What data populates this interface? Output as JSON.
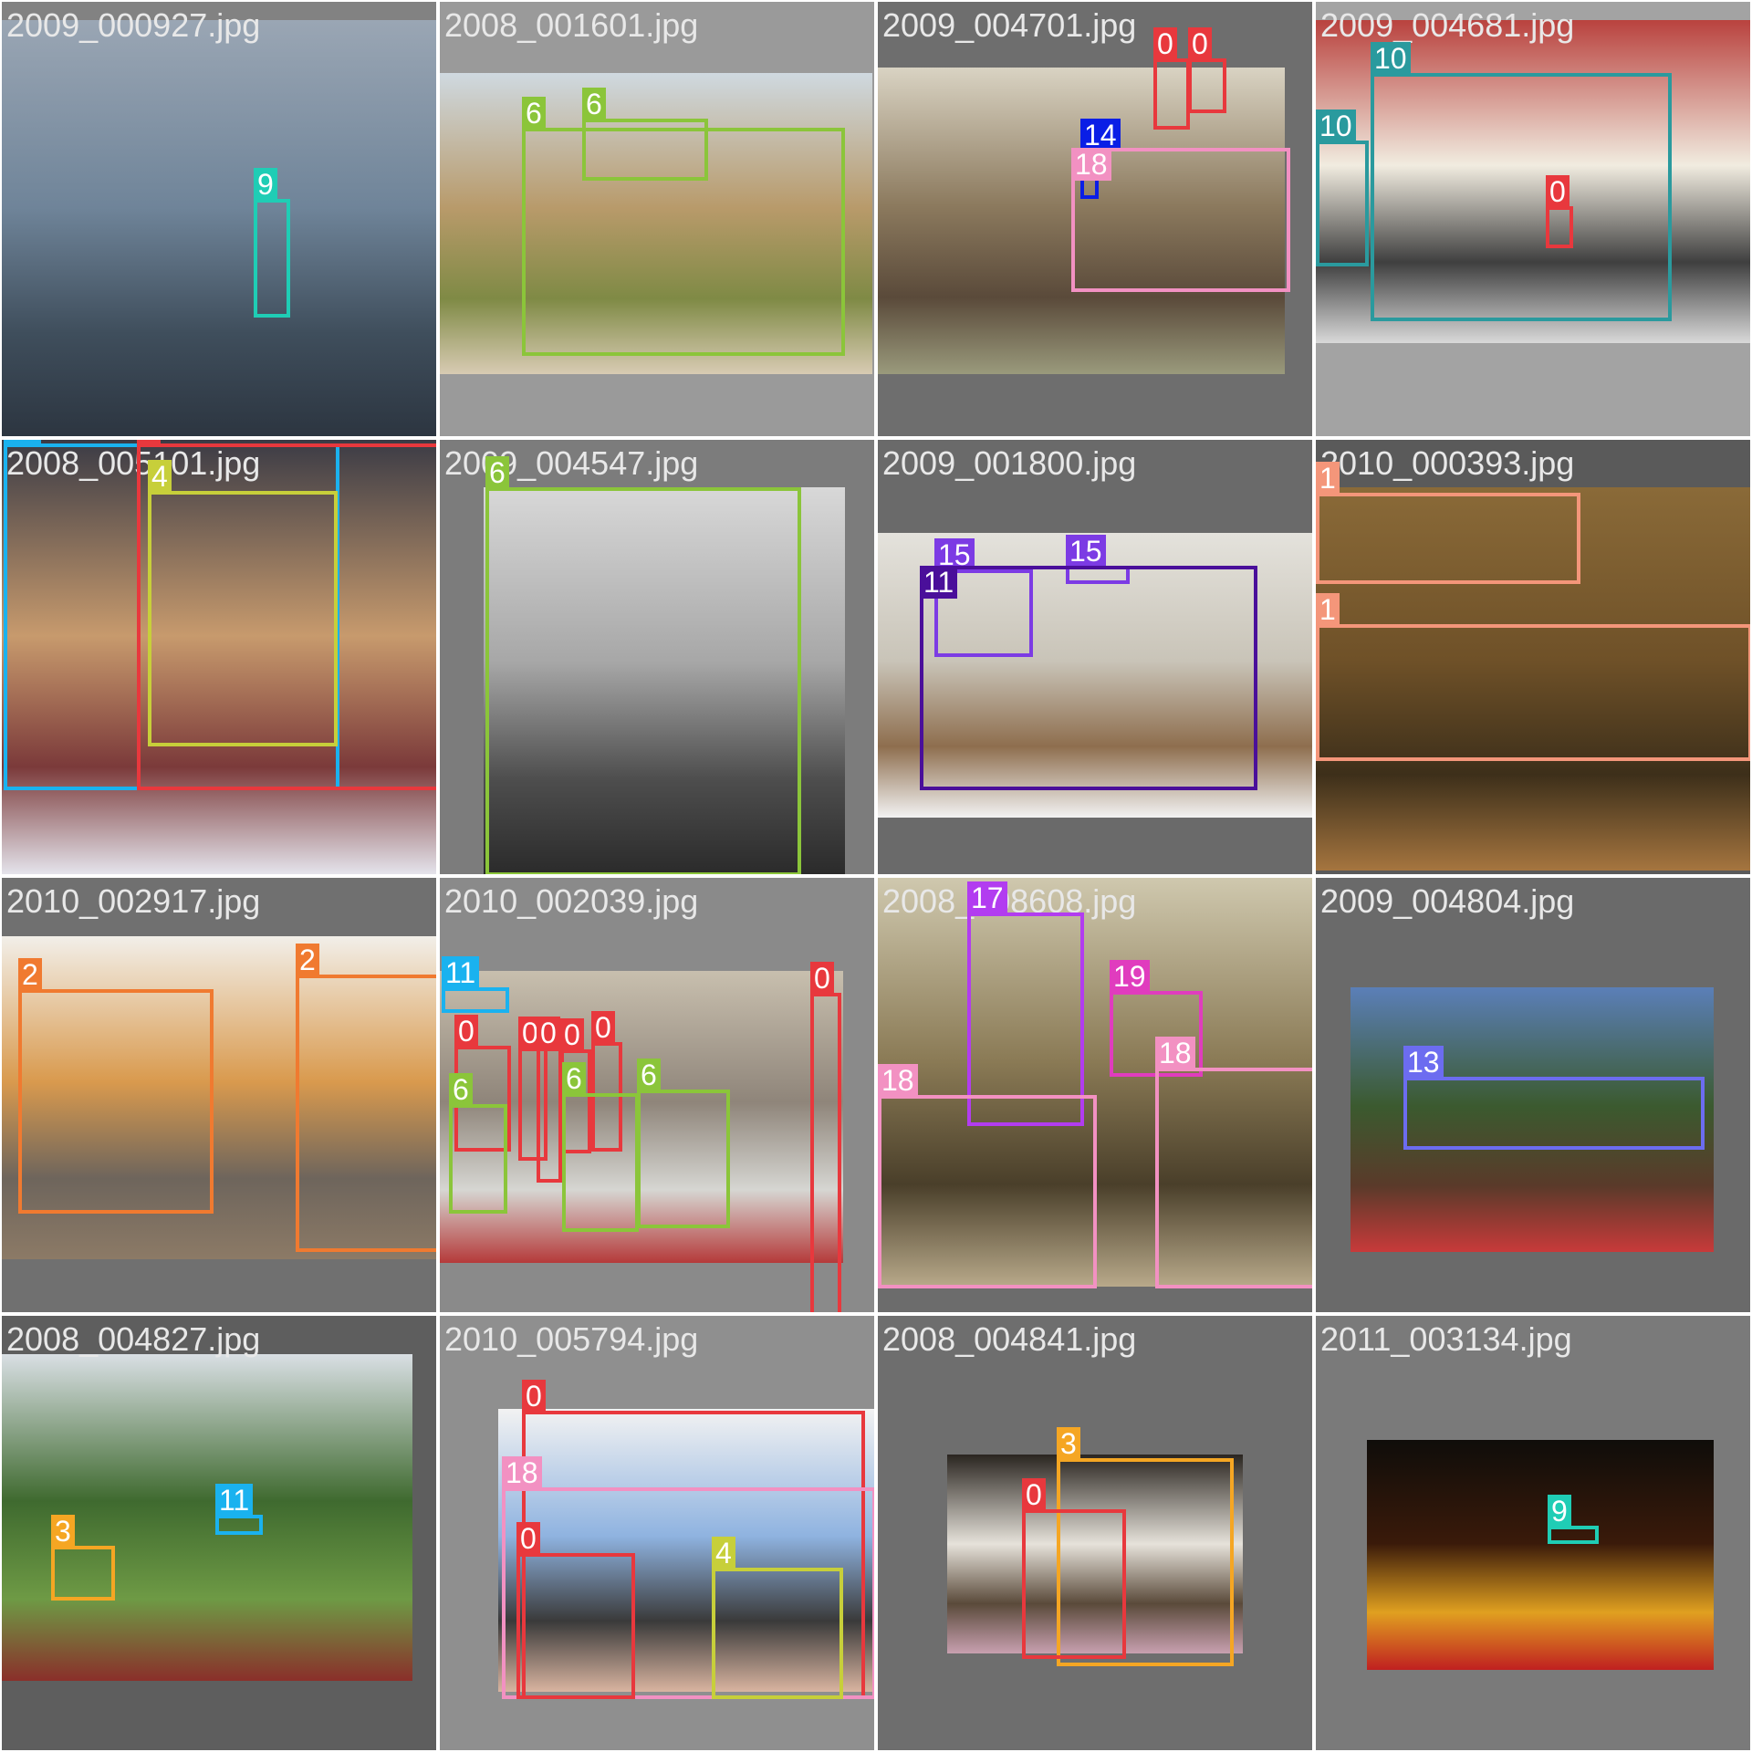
{
  "mosaic": {
    "cells": [
      {
        "filename": "2009_000927.jpg",
        "background": "#828282",
        "image": {
          "scene": "city skyline over water",
          "colors": [
            "#9aa6b4",
            "#6f8499",
            "#3f4e5c",
            "#2c3540"
          ]
        },
        "boxes": [
          {
            "label": "9",
            "color": "#1fcdb5"
          }
        ]
      },
      {
        "filename": "2008_001601.jpg",
        "background": "#9a9a9a",
        "image": {
          "scene": "sheep in grass",
          "colors": [
            "#cfd9e0",
            "#b89a6a",
            "#7f8a45",
            "#d8cbb3"
          ]
        },
        "boxes": [
          {
            "label": "6",
            "color": "#8bc53a"
          },
          {
            "label": "6",
            "color": "#8bc53a"
          }
        ]
      },
      {
        "filename": "2009_004701.jpg",
        "background": "#6e6e6e",
        "image": {
          "scene": "living room with sofa",
          "colors": [
            "#d9d3c3",
            "#8c7a5e",
            "#5a4a3a",
            "#9a9a7c"
          ]
        },
        "boxes": [
          {
            "label": "0",
            "color": "#e8383d"
          },
          {
            "label": "0",
            "color": "#e8383d"
          },
          {
            "label": "14",
            "color": "#0a1ee6"
          },
          {
            "label": "18",
            "color": "#f291c2"
          }
        ]
      },
      {
        "filename": "2009_004681.jpg",
        "background": "#a3a3a3",
        "image": {
          "scene": "double-decker bus",
          "colors": [
            "#b9423e",
            "#f1ece0",
            "#3f3f3f",
            "#d9d9d9"
          ]
        },
        "boxes": [
          {
            "label": "10",
            "color": "#2a9a9e"
          },
          {
            "label": "10",
            "color": "#2a9a9e"
          },
          {
            "label": "0",
            "color": "#e8383d"
          }
        ]
      },
      {
        "filename": "2008_005101.jpg",
        "background": "#555555",
        "image": {
          "scene": "puppy in gloved hands",
          "colors": [
            "#3b3b45",
            "#c79a6d",
            "#7b3a3a",
            "#e6e6ee"
          ]
        },
        "boxes": [
          {
            "label": "11",
            "color": "#1ab2ef"
          },
          {
            "label": "0",
            "color": "#e8383d"
          },
          {
            "label": "4",
            "color": "#c7cf3a"
          }
        ]
      },
      {
        "filename": "2009_004547.jpg",
        "background": "#7c7c7c",
        "image": {
          "scene": "sheep face close-up (grayscale)",
          "colors": [
            "#d8d8d8",
            "#a7a7a7",
            "#4e4e4e",
            "#2a2a2a"
          ]
        },
        "boxes": [
          {
            "label": "6",
            "color": "#8bc53a"
          }
        ]
      },
      {
        "filename": "2009_001800.jpg",
        "background": "#6a6a6a",
        "image": {
          "scene": "dining table with vase",
          "colors": [
            "#e4e2dc",
            "#c9c4b8",
            "#8e6e4e",
            "#f2f2f2"
          ]
        },
        "boxes": [
          {
            "label": "15",
            "color": "#7c3be4"
          },
          {
            "label": "15",
            "color": "#7c3be4"
          },
          {
            "label": "11",
            "color": "#4a0f9a"
          }
        ]
      },
      {
        "filename": "2010_000393.jpg",
        "background": "#5a5a5a",
        "image": {
          "scene": "two birds of prey flying",
          "colors": [
            "#8a6a38",
            "#6f5128",
            "#3d2f1a",
            "#a5753f"
          ]
        },
        "boxes": [
          {
            "label": "1",
            "color": "#f4967a"
          },
          {
            "label": "1",
            "color": "#f4967a"
          }
        ]
      },
      {
        "filename": "2010_002917.jpg",
        "background": "#707070",
        "image": {
          "scene": "two cats indoors",
          "colors": [
            "#f2efe9",
            "#d99a4e",
            "#6e655c",
            "#8c7a66"
          ]
        },
        "boxes": [
          {
            "label": "2",
            "color": "#f07a30"
          },
          {
            "label": "2",
            "color": "#f07a30"
          }
        ]
      },
      {
        "filename": "2010_002039.jpg",
        "background": "#8a8a8a",
        "image": {
          "scene": "children and sheep by stone wall",
          "colors": [
            "#c8bfae",
            "#8f857a",
            "#d6d6d2",
            "#b53a3a"
          ]
        },
        "boxes": [
          {
            "label": "11",
            "color": "#1ab2ef"
          },
          {
            "label": "0",
            "color": "#e8383d"
          },
          {
            "label": "0",
            "color": "#e8383d"
          },
          {
            "label": "0",
            "color": "#e8383d"
          },
          {
            "label": "0",
            "color": "#e8383d"
          },
          {
            "label": "0",
            "color": "#e8383d"
          },
          {
            "label": "0",
            "color": "#e8383d"
          },
          {
            "label": "6",
            "color": "#8bc53a"
          },
          {
            "label": "6",
            "color": "#8bc53a"
          },
          {
            "label": "6",
            "color": "#8bc53a"
          }
        ]
      },
      {
        "filename": "2008_008608.jpg",
        "background": "#6c6c6c",
        "image": {
          "scene": "living room with plant and TV",
          "colors": [
            "#cfc8ae",
            "#8a7a55",
            "#4a3f2a",
            "#b8a98a"
          ]
        },
        "boxes": [
          {
            "label": "17",
            "color": "#b23cf0"
          },
          {
            "label": "19",
            "color": "#e03cbe"
          },
          {
            "label": "18",
            "color": "#f291c2"
          },
          {
            "label": "18",
            "color": "#f291c2"
          }
        ]
      },
      {
        "filename": "2009_004804.jpg",
        "background": "#6a6a6a",
        "image": {
          "scene": "red train crossing field",
          "colors": [
            "#5b7fb8",
            "#3b5a2f",
            "#5a3a2a",
            "#c83a3a"
          ]
        },
        "boxes": [
          {
            "label": "13",
            "color": "#6c6cf0"
          }
        ]
      },
      {
        "filename": "2008_004827.jpg",
        "background": "#5e5e5e",
        "image": {
          "scene": "farm with cow and trees",
          "colors": [
            "#d9dfe4",
            "#3f6a2f",
            "#6e9a45",
            "#8a2f2a"
          ]
        },
        "boxes": [
          {
            "label": "3",
            "color": "#f5a623"
          },
          {
            "label": "11",
            "color": "#1ab2ef"
          }
        ]
      },
      {
        "filename": "2010_005794.jpg",
        "background": "#8f8f8f",
        "image": {
          "scene": "man with baby and dog",
          "colors": [
            "#f2f2f2",
            "#8fb3e0",
            "#3a3a3a",
            "#d9b4a0"
          ]
        },
        "boxes": [
          {
            "label": "0",
            "color": "#e8383d"
          },
          {
            "label": "18",
            "color": "#f291c2"
          },
          {
            "label": "0",
            "color": "#e8383d"
          },
          {
            "label": "4",
            "color": "#c7cf3a"
          }
        ]
      },
      {
        "filename": "2008_004841.jpg",
        "background": "#6e6e6e",
        "image": {
          "scene": "child milking cow",
          "colors": [
            "#2a2520",
            "#e6e2da",
            "#5a4a3a",
            "#c8a0b0"
          ]
        },
        "boxes": [
          {
            "label": "3",
            "color": "#f5a623"
          },
          {
            "label": "0",
            "color": "#e8383d"
          }
        ]
      },
      {
        "filename": "2011_003134.jpg",
        "background": "#7a7a7a",
        "image": {
          "scene": "city lights at night over water",
          "colors": [
            "#0f0d0a",
            "#3a1a0a",
            "#e0a020",
            "#c02020"
          ]
        },
        "boxes": [
          {
            "label": "9",
            "color": "#1fcdb5"
          }
        ]
      }
    ]
  }
}
